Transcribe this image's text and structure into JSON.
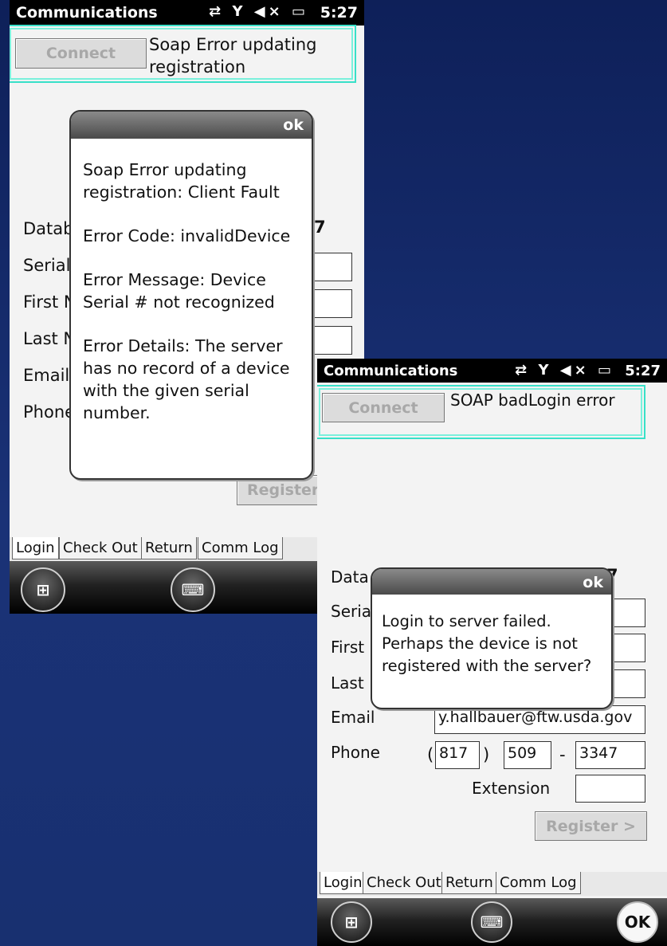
{
  "screenA": {
    "status": {
      "title": "Communications",
      "time": "5:27"
    },
    "connect_label": "Connect",
    "status_message": "Soap Error updating registration",
    "labels": {
      "database": "Datab",
      "serial": "Serial",
      "first": "First N",
      "last": "Last N",
      "email": "Email",
      "phone": "Phone"
    },
    "database_value": "7",
    "register_label": "Register",
    "tabs": [
      "Login",
      "Check Out",
      "Return",
      "Comm Log"
    ],
    "dialog": {
      "ok_label": "ok",
      "paragraphs": [
        "Soap Error updating registration: Client Fault",
        "Error Code: invalidDevice",
        "Error Message: Device Serial # not recognized",
        "Error Details: The server has no record of a device with the given serial number."
      ]
    }
  },
  "screenB": {
    "status": {
      "title": "Communications",
      "time": "5:27"
    },
    "connect_label": "Connect",
    "status_message": "SOAP badLogin error",
    "labels": {
      "database": "Data",
      "serial": "Seria",
      "first": "First",
      "last": "Last",
      "email": "Email",
      "phone": "Phone",
      "extension": "Extension"
    },
    "database_value": "7",
    "email_value": "y.hallbauer@ftw.usda.gov",
    "phone": {
      "area": "817",
      "prefix": "509",
      "line": "3347",
      "open_paren": "(",
      "close_paren": ")",
      "dash": "-"
    },
    "extension_value": "",
    "register_label": "Register >",
    "tabs": [
      "Login",
      "Check Out",
      "Return",
      "Comm Log"
    ],
    "ok_button": "OK",
    "dialog": {
      "ok_label": "ok",
      "message": "Login to server failed. Perhaps the device is not registered with the server?"
    }
  }
}
